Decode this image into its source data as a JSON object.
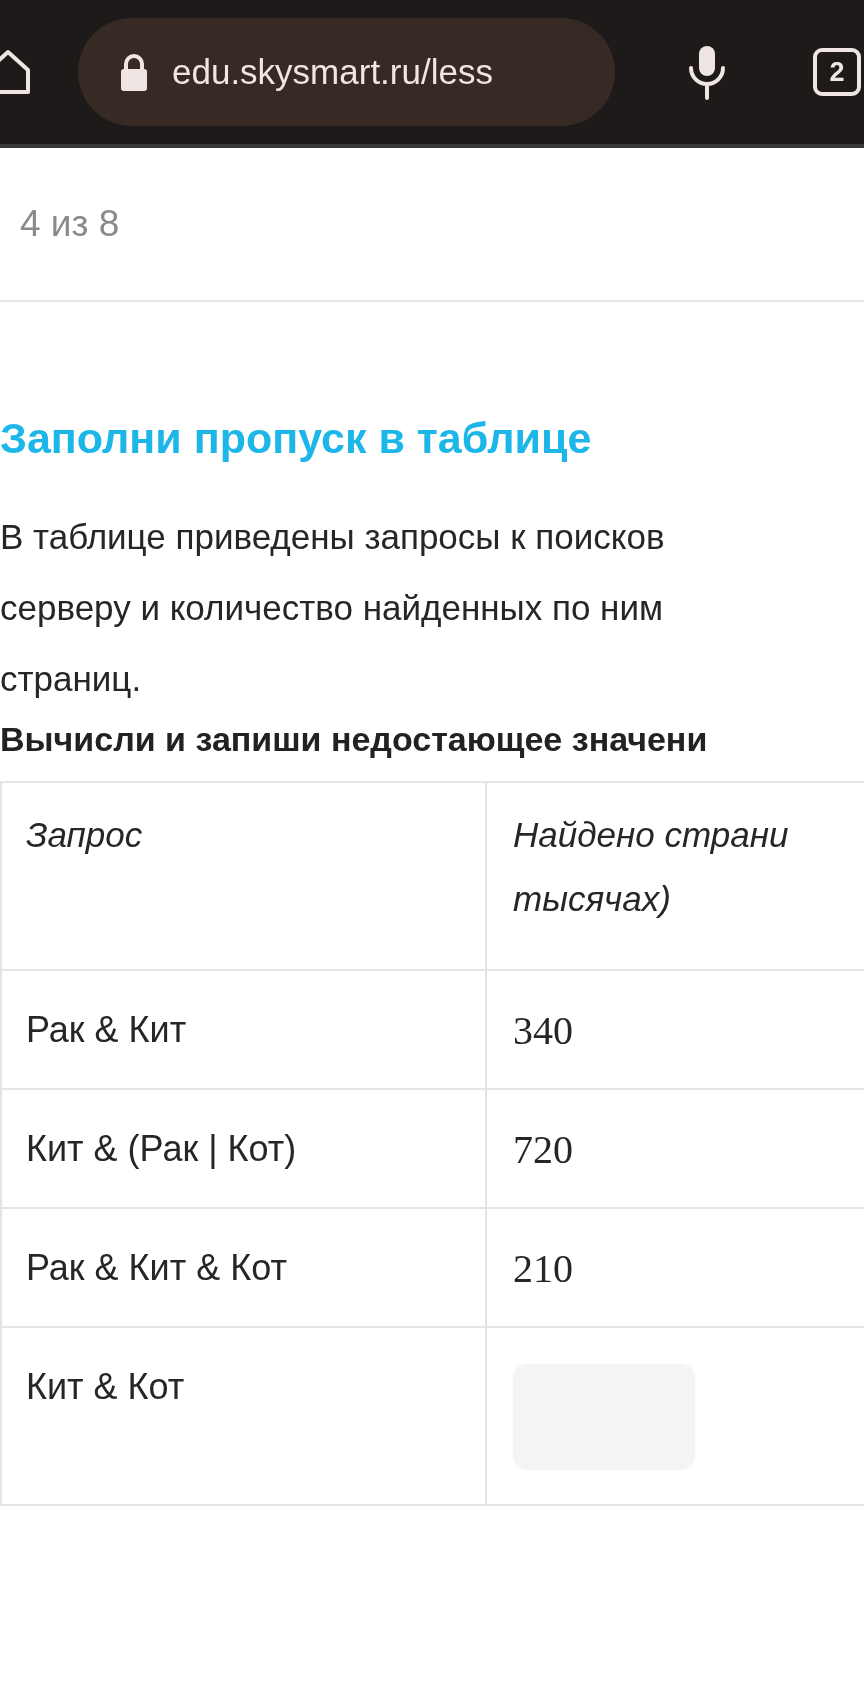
{
  "browser": {
    "url": "edu.skysmart.ru/less",
    "tab_count": "2"
  },
  "progress": "4 из 8",
  "task": {
    "title": "Заполни пропуск в таблице",
    "description_lines": [
      "В таблице приведены запросы к поисков",
      "серверу и количество найденных по ним",
      "страниц."
    ],
    "instruction": "Вычисли и запиши недостающее значени"
  },
  "table": {
    "columns": [
      {
        "lines": [
          "Запрос"
        ]
      },
      {
        "lines": [
          "Найдено страни",
          "тысячах)"
        ]
      }
    ],
    "rows": [
      {
        "query": "Рак & Кит",
        "kind": "value",
        "pages": "340"
      },
      {
        "query": "Кит & (Рак | Кот)",
        "kind": "value",
        "pages": "720"
      },
      {
        "query": "Рак & Кит & Кот",
        "kind": "value",
        "pages": "210"
      },
      {
        "query": "Кит & Кот",
        "kind": "field"
      }
    ]
  }
}
